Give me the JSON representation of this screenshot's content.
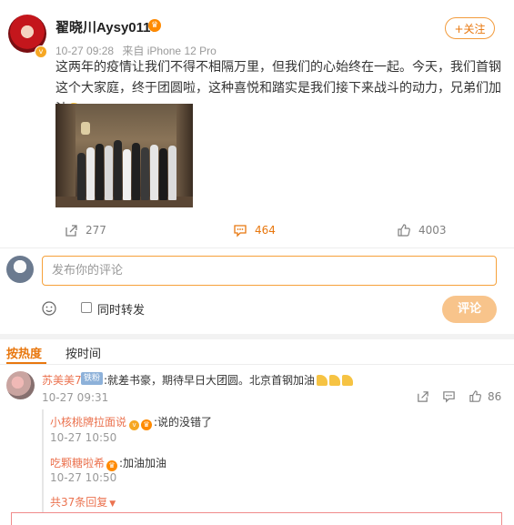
{
  "post": {
    "author": "翟晓川Aysy0118",
    "time": "10-27 09:28",
    "source": "来自 iPhone 12 Pro",
    "follow_label": "+关注",
    "text": "这两年的疫情让我们不得不相隔万里，但我们的心始终在一起。今天，我们首钢这个大家庭，终于团圆啦，这种喜悦和踏实是我们接下来战斗的动力，兄弟们加油",
    "repost_count": "277",
    "comment_count": "464",
    "like_count": "4003"
  },
  "compose": {
    "placeholder": "发布你的评论",
    "repost_label": "同时转发",
    "submit_label": "评论"
  },
  "sort": {
    "hot_label": "按热度",
    "time_label": "按时间"
  },
  "comments": [
    {
      "user": "苏美美7",
      "badge": "铁粉",
      "text": ":就差书豪，期待早日大团圆。北京首钢加油",
      "time": "10-27 09:31",
      "likes": "86",
      "replies": [
        {
          "user": "小核桃牌拉面说",
          "text": ":说的没错了",
          "time": "10-27 10:50"
        },
        {
          "user": "吃颗糖啦希",
          "text": ":加油加油",
          "time": "10-27 10:50"
        }
      ],
      "more_replies": "共37条回复"
    }
  ],
  "colors": {
    "accent": "#e8770e",
    "link": "#eb7350",
    "submit_disabled": "#f8c48b"
  }
}
